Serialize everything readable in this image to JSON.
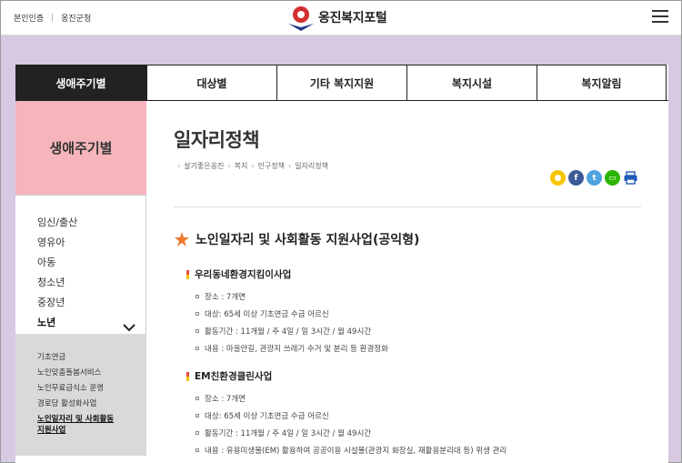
{
  "header": {
    "util_links": [
      "본인인증",
      "옹진군청"
    ],
    "logo_text": "옹진복지포털"
  },
  "nav": {
    "tabs": [
      "생애주기별",
      "대상별",
      "기타 복지지원",
      "복지시설",
      "복지알림"
    ]
  },
  "sidebar": {
    "title": "생애주기별",
    "items": [
      "임신/출산",
      "영유아",
      "아동",
      "청소년",
      "중장년",
      "노년"
    ],
    "sub_items": [
      "기초연금",
      "노인맞춤돌봄서비스",
      "노인무료급식소 운영",
      "경로당 활성화사업",
      "노인일자리 및 사회활동",
      "지원사업"
    ]
  },
  "main": {
    "title": "일자리정책",
    "breadcrumb": [
      "살기좋은옹진",
      "복지",
      "인구정책",
      "일자리정책"
    ],
    "section_title": "노인일자리 및 사회활동 지원사업(공익형)",
    "programs": [
      {
        "name": "우리동네환경지킴이사업",
        "details": [
          "장소 : 7개면",
          "대상: 65세 이상 기초연금 수급 어르신",
          "활동기간 : 11개월 / 주 4일 / 일 3시간 / 월 49시간",
          "내용 : 마을안길, 관광지 쓰레기 수거 및 분리 등 환경정화"
        ]
      },
      {
        "name": "EM친환경클린사업",
        "details": [
          "장소 : 7개면",
          "대상: 65세 이상 기초연금 수급 어르신",
          "활동기간 : 11개월 / 주 4일 / 일 3시간 / 월 49시간",
          "내용 : 유용미생물(EM) 활용하여 공공이용 시설물(관광지 화장실, 재활용분리대 등) 위생 관리"
        ]
      }
    ]
  },
  "colors": {
    "background": "#d7c9e2",
    "sidebar_title_bg": "#f5b5ba",
    "nav_active_bg": "#222222",
    "sub_menu_bg": "#d9d9d9"
  }
}
